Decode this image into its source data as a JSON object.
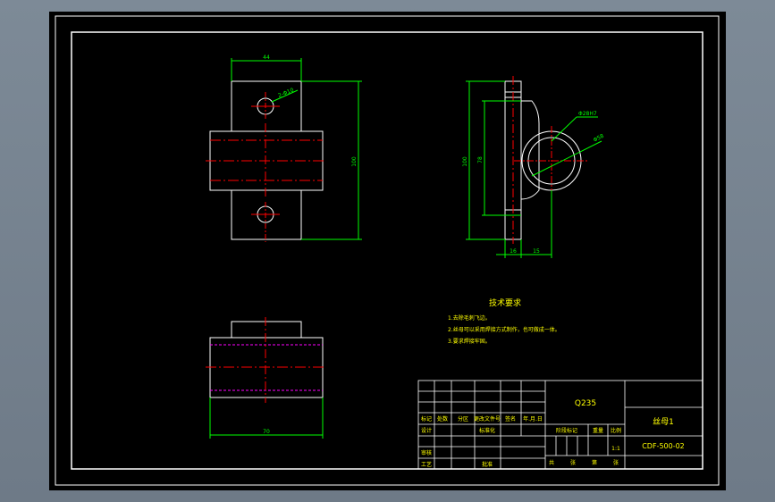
{
  "dimensions": {
    "front_width": "44",
    "hole_callout": "2-Φ10",
    "front_height": "100",
    "side_height": "100",
    "side_inner_height": "78",
    "bore_fit": "Φ28H7",
    "bore_outer": "Φ58",
    "flange_thickness": "16",
    "boss_offset": "15",
    "top_width": "70"
  },
  "tech": {
    "title": "技术要求",
    "notes": [
      "1.去除毛刺飞边。",
      "2.丝母可以采用焊接方式制作，也可做成一体。",
      "3.要求焊接牢固。"
    ]
  },
  "title_block": {
    "material": "Q235",
    "part_name": "丝母1",
    "drawing_no": "CDF-500-02",
    "scale": "1:1",
    "label_marks": "标记",
    "label_count": "处数",
    "label_zone": "分区",
    "label_change_doc": "更改文件号",
    "label_signature": "签名",
    "label_date": "年.月.日",
    "label_design": "设计",
    "label_standardize": "标准化",
    "label_stage": "阶段标记",
    "label_weight": "重量",
    "label_scale": "比例",
    "label_check": "审核",
    "label_process": "工艺",
    "label_approve": "批准",
    "label_sheets": "共",
    "label_sheet_of": "张",
    "label_sheet_no": "第",
    "label_sheet_end": "张"
  },
  "colors": {
    "outline": "#ffffff",
    "dimension": "#00ff00",
    "centerline": "#ff0000",
    "hidden": "#ff00ff",
    "note_text": "#ffff00",
    "border": "#ffffff"
  }
}
